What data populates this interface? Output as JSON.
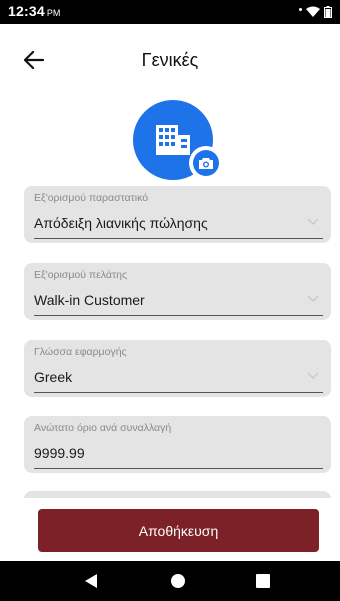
{
  "status_bar": {
    "time": "12:34",
    "ampm": "PM"
  },
  "header": {
    "title": "Γενικές"
  },
  "fields": [
    {
      "label": "Εξ'ορισμού παραστατικό",
      "value": "Απόδειξη λιανικής πώλησης",
      "has_dropdown": true
    },
    {
      "label": "Εξ'ορισμού πελάτης",
      "value": "Walk-in Customer",
      "has_dropdown": true
    },
    {
      "label": "Γλώσσα εφαρμογής",
      "value": "Greek",
      "has_dropdown": true
    },
    {
      "label": "Ανώτατο όριο ανά συναλλαγή",
      "value": "9999.99",
      "has_dropdown": false
    }
  ],
  "actions": {
    "save_label": "Αποθήκευση"
  },
  "colors": {
    "accent": "#1e73e8",
    "primary_button": "#7d2128",
    "field_bg": "#e4e4e4"
  },
  "icons": {
    "back": "arrow-left-icon",
    "avatar": "building-icon",
    "camera": "camera-icon",
    "dropdown": "chevron-down-icon",
    "nav_back": "triangle-back-icon",
    "nav_home": "circle-home-icon",
    "nav_recent": "square-recent-icon"
  }
}
